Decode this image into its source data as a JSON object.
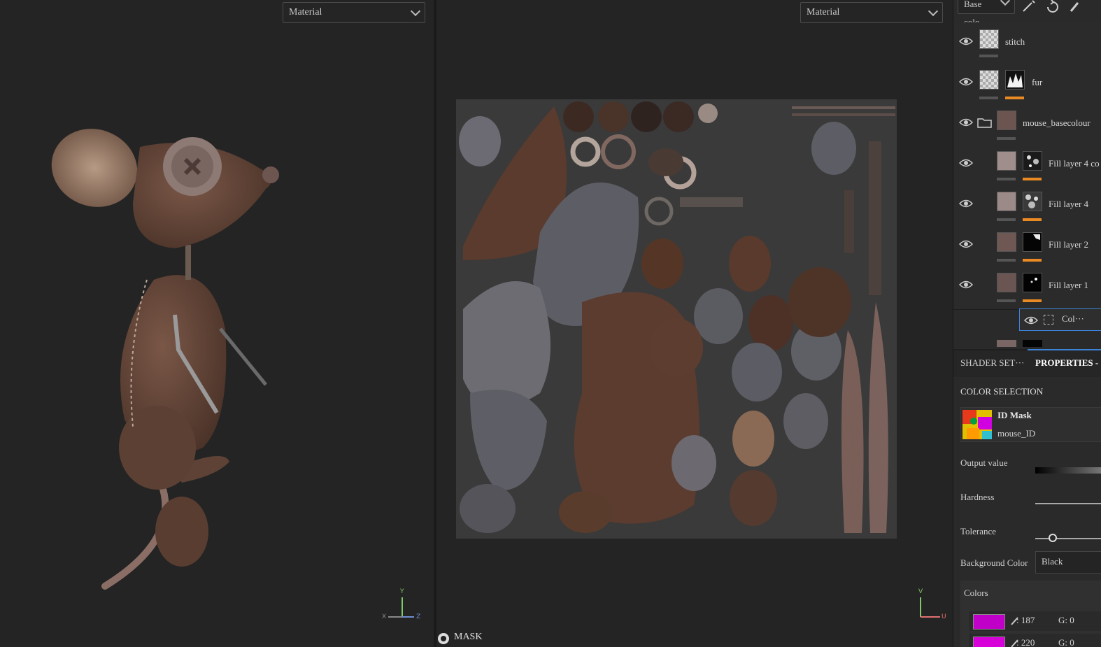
{
  "viewport3d": {
    "mode_select": "Material",
    "axes": {
      "up": "Y",
      "left": "X",
      "right": "Z"
    }
  },
  "viewport2d": {
    "mode_select": "Material",
    "axes": {
      "up": "V",
      "right": "U"
    },
    "mask_label": "MASK"
  },
  "toolbar": {
    "channel_select": "Base colo",
    "icons": [
      "magic-wand-icon",
      "refresh-icon",
      "brush-icon"
    ]
  },
  "layers": [
    {
      "name": "stitch",
      "type": "layer"
    },
    {
      "name": "fur",
      "type": "layer"
    },
    {
      "name": "mouse_basecolour",
      "type": "folder"
    },
    {
      "name": "Fill layer 4 co",
      "type": "fill"
    },
    {
      "name": "Fill layer 4",
      "type": "fill"
    },
    {
      "name": "Fill layer 2",
      "type": "fill"
    },
    {
      "name": "Fill layer 1",
      "type": "fill"
    }
  ],
  "effect_row": {
    "label": "Col···"
  },
  "tabs": {
    "shader": "SHADER SET···",
    "properties": "PROPERTIES -"
  },
  "properties": {
    "section_title": "COLOR SELECTION",
    "id_mask": {
      "title": "ID Mask",
      "subtitle": "mouse_ID"
    },
    "output_value_label": "Output value",
    "hardness_label": "Hardness",
    "tolerance_label": "Tolerance",
    "background_color_label": "Background Color",
    "background_color_value": "Black",
    "colors_label": "Colors",
    "color_rows": [
      {
        "swatch": "#c000c8",
        "r_label": ": 187",
        "g_label": "G: 0"
      },
      {
        "swatch": "#d800d8",
        "r_label": ": 220",
        "g_label": "G: 0"
      }
    ]
  },
  "colors": {
    "accent_orange": "#e98a23",
    "selection_blue": "#3c84d8",
    "mouse_brown": "#6e4f40"
  }
}
